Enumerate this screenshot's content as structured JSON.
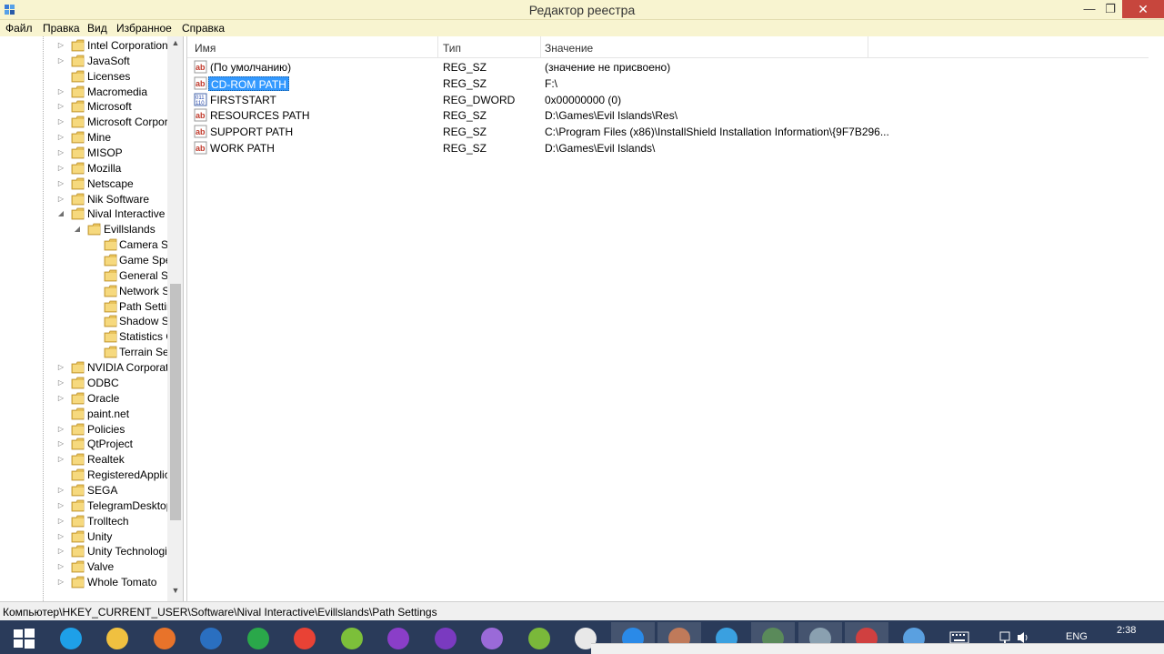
{
  "window": {
    "title": "Редактор реестра",
    "minimize": "—",
    "maximize": "❐",
    "close": "✕"
  },
  "menu": [
    "Файл",
    "Правка",
    "Вид",
    "Избранное",
    "Справка"
  ],
  "tree": {
    "items": [
      {
        "label": "Intel Corporation",
        "level": 1,
        "expander": "▷"
      },
      {
        "label": "JavaSoft",
        "level": 1,
        "expander": "▷"
      },
      {
        "label": "Licenses",
        "level": 1,
        "expander": ""
      },
      {
        "label": "Macromedia",
        "level": 1,
        "expander": "▷"
      },
      {
        "label": "Microsoft",
        "level": 1,
        "expander": "▷"
      },
      {
        "label": "Microsoft Corpora",
        "level": 1,
        "expander": "▷"
      },
      {
        "label": "Mine",
        "level": 1,
        "expander": "▷"
      },
      {
        "label": "MISOP",
        "level": 1,
        "expander": "▷"
      },
      {
        "label": "Mozilla",
        "level": 1,
        "expander": "▷"
      },
      {
        "label": "Netscape",
        "level": 1,
        "expander": "▷"
      },
      {
        "label": "Nik Software",
        "level": 1,
        "expander": "▷"
      },
      {
        "label": "Nival Interactive",
        "level": 1,
        "expander": "◢"
      },
      {
        "label": "Evillslands",
        "level": 2,
        "expander": "◢"
      },
      {
        "label": "Camera Se",
        "level": 3,
        "expander": ""
      },
      {
        "label": "Game Spec",
        "level": 3,
        "expander": ""
      },
      {
        "label": "General Set",
        "level": 3,
        "expander": ""
      },
      {
        "label": "Network Se",
        "level": 3,
        "expander": ""
      },
      {
        "label": "Path Settin",
        "level": 3,
        "expander": "",
        "selected": true
      },
      {
        "label": "Shadow Se",
        "level": 3,
        "expander": ""
      },
      {
        "label": "Statistics O",
        "level": 3,
        "expander": ""
      },
      {
        "label": "Terrain Set",
        "level": 3,
        "expander": ""
      },
      {
        "label": "NVIDIA Corporatio",
        "level": 1,
        "expander": "▷"
      },
      {
        "label": "ODBC",
        "level": 1,
        "expander": "▷"
      },
      {
        "label": "Oracle",
        "level": 1,
        "expander": "▷"
      },
      {
        "label": "paint.net",
        "level": 1,
        "expander": ""
      },
      {
        "label": "Policies",
        "level": 1,
        "expander": "▷"
      },
      {
        "label": "QtProject",
        "level": 1,
        "expander": "▷"
      },
      {
        "label": "Realtek",
        "level": 1,
        "expander": "▷"
      },
      {
        "label": "RegisteredApplica",
        "level": 1,
        "expander": ""
      },
      {
        "label": "SEGA",
        "level": 1,
        "expander": "▷"
      },
      {
        "label": "TelegramDesktop",
        "level": 1,
        "expander": "▷"
      },
      {
        "label": "Trolltech",
        "level": 1,
        "expander": "▷"
      },
      {
        "label": "Unity",
        "level": 1,
        "expander": "▷"
      },
      {
        "label": "Unity Technologie",
        "level": 1,
        "expander": "▷"
      },
      {
        "label": "Valve",
        "level": 1,
        "expander": "▷"
      },
      {
        "label": "Whole Tomato",
        "level": 1,
        "expander": "▷"
      }
    ],
    "scroll_up": "▲",
    "scroll_down": "▼"
  },
  "list": {
    "columns": {
      "name": "Имя",
      "type": "Тип",
      "value": "Значение"
    },
    "rows": [
      {
        "icon": "string-value-icon",
        "name": "(По умолчанию)",
        "type": "REG_SZ",
        "value": "(значение не присвоено)"
      },
      {
        "icon": "string-value-icon",
        "name": "CD-ROM PATH",
        "type": "REG_SZ",
        "value": "F:\\",
        "selected": true
      },
      {
        "icon": "dword-value-icon",
        "name": "FIRSTSTART",
        "type": "REG_DWORD",
        "value": "0x00000000 (0)"
      },
      {
        "icon": "string-value-icon",
        "name": "RESOURCES PATH",
        "type": "REG_SZ",
        "value": "D:\\Games\\Evil Islands\\Res\\"
      },
      {
        "icon": "string-value-icon",
        "name": "SUPPORT PATH",
        "type": "REG_SZ",
        "value": "C:\\Program Files (x86)\\InstallShield Installation Information\\{9F7B296..."
      },
      {
        "icon": "string-value-icon",
        "name": "WORK PATH",
        "type": "REG_SZ",
        "value": "D:\\Games\\Evil Islands\\"
      }
    ]
  },
  "status": {
    "path": "Компьютер\\HKEY_CURRENT_USER\\Software\\Nival Interactive\\Evillslands\\Path Settings"
  },
  "taskbar": {
    "apps": [
      "windows-start-icon",
      "internet-explorer-icon",
      "file-explorer-icon",
      "firefox-icon",
      "thunderbird-icon",
      "store-icon",
      "chrome-icon",
      "notepad-icon",
      "visual-studio-icon",
      "visual-studio-2-icon",
      "visual-studio-3-icon",
      "android-studio-icon",
      "media-icon",
      "help-icon",
      "avatar-icon",
      "telegram-icon",
      "network-grid-icon",
      "task-manager-icon",
      "tools-icon",
      "remote-desktop-icon"
    ],
    "lang": "ENG",
    "time": "2:38"
  },
  "colors": {
    "titlebar": "#f8f4d0",
    "selection": "#3399ff",
    "close": "#c7463d",
    "taskbar": "#2a3b5a"
  }
}
